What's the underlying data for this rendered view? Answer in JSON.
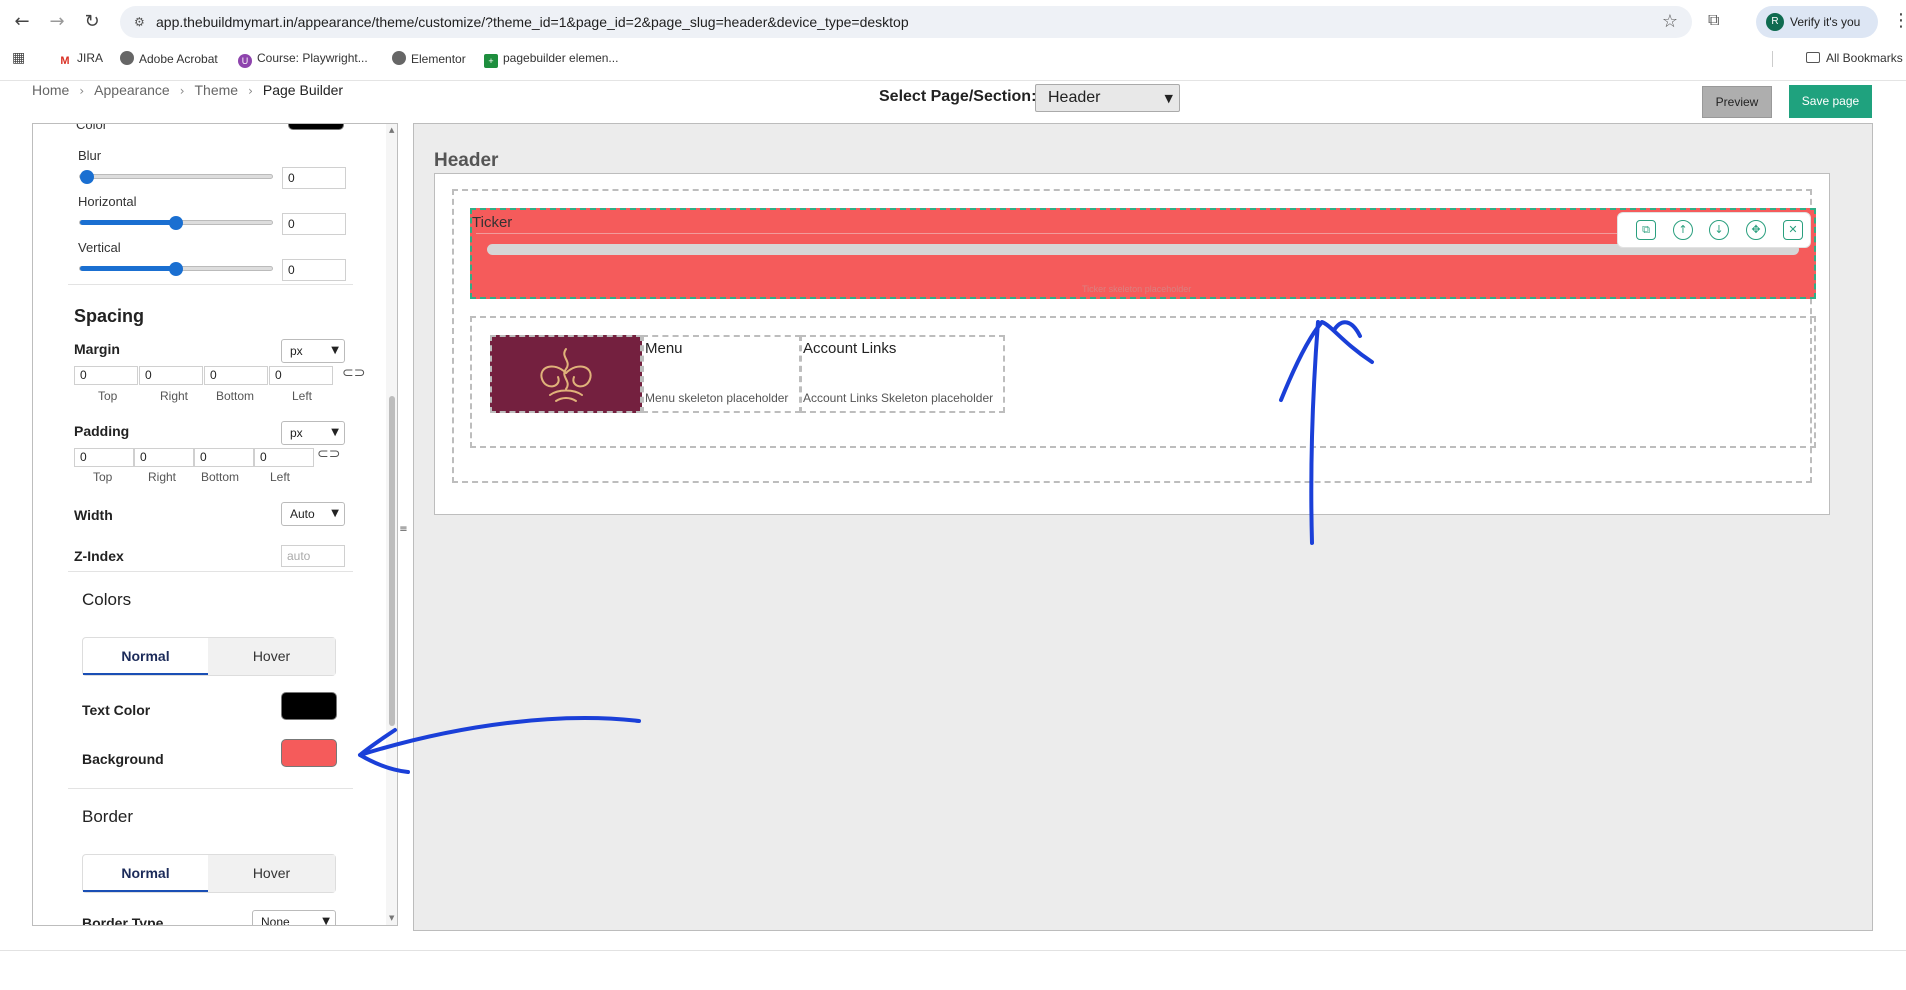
{
  "browser": {
    "url": "app.thebuildmymart.in/appearance/theme/customize/?theme_id=1&page_id=2&page_slug=header&device_type=desktop",
    "profile_initial": "R",
    "profile_label": "Verify it's you",
    "icons": [
      "back-icon",
      "forward-icon",
      "reload-icon",
      "site-info-icon",
      "star-icon",
      "extensions-icon",
      "menu-icon"
    ]
  },
  "bookmarks": {
    "items": [
      {
        "label": "JIRA",
        "color": "#d93025",
        "glyph": "M"
      },
      {
        "label": "Adobe Acrobat",
        "color": "#555555",
        "glyph": "⊕"
      },
      {
        "label": "Course: Playwright...",
        "color": "#8e44ad",
        "glyph": "U"
      },
      {
        "label": "Elementor",
        "color": "#555555",
        "glyph": "⊕"
      },
      {
        "label": "pagebuilder elemen...",
        "color": "#1e8e3e",
        "glyph": "+"
      }
    ],
    "all_label": "All Bookmarks"
  },
  "breadcrumb": [
    "Home",
    "Appearance",
    "Theme",
    "Page Builder"
  ],
  "header_bar": {
    "select_label": "Select Page/Section:",
    "select_value": "Header",
    "preview_label": "Preview",
    "save_label": "Save page"
  },
  "panel": {
    "cut_label": "Color",
    "blur": {
      "label": "Blur",
      "value": "0",
      "level": 0.0
    },
    "horizontal": {
      "label": "Horizontal",
      "value": "0",
      "level": 0.5
    },
    "vertical": {
      "label": "Vertical",
      "value": "0",
      "level": 0.5
    },
    "spacing_title": "Spacing",
    "margin": {
      "label": "Margin",
      "unit": "px",
      "values": [
        "0",
        "0",
        "0",
        "0"
      ],
      "sides": [
        "Top",
        "Right",
        "Bottom",
        "Left"
      ]
    },
    "padding": {
      "label": "Padding",
      "unit": "px",
      "values": [
        "0",
        "0",
        "0",
        "0"
      ],
      "sides": [
        "Top",
        "Right",
        "Bottom",
        "Left"
      ]
    },
    "width": {
      "label": "Width",
      "value": "Auto"
    },
    "zindex": {
      "label": "Z-Index",
      "placeholder": "auto"
    },
    "colors": {
      "title": "Colors",
      "tab_normal": "Normal",
      "tab_hover": "Hover",
      "text_color_label": "Text Color",
      "text_color": "#000000",
      "background_label": "Background",
      "background_color": "#f55b5b"
    },
    "border": {
      "title": "Border",
      "tab_normal": "Normal",
      "tab_hover": "Hover",
      "type_label": "Border Type",
      "type_value": "None"
    }
  },
  "canvas": {
    "title": "Header",
    "ticker": {
      "label": "Ticker",
      "placeholder": "Ticker skeleton placeholder",
      "background": "#f55b5b"
    },
    "toolbar_icons": [
      "duplicate-icon",
      "move-up-icon",
      "move-down-icon",
      "drag-icon",
      "delete-icon"
    ],
    "menu": {
      "title": "Menu",
      "placeholder": "Menu skeleton placeholder"
    },
    "account": {
      "title": "Account Links",
      "placeholder": "Account Links Skeleton placeholder"
    },
    "logo_color": "#74203f"
  },
  "colors": {
    "accent": "#1fa27e",
    "annotation": "#1a3fd8"
  }
}
